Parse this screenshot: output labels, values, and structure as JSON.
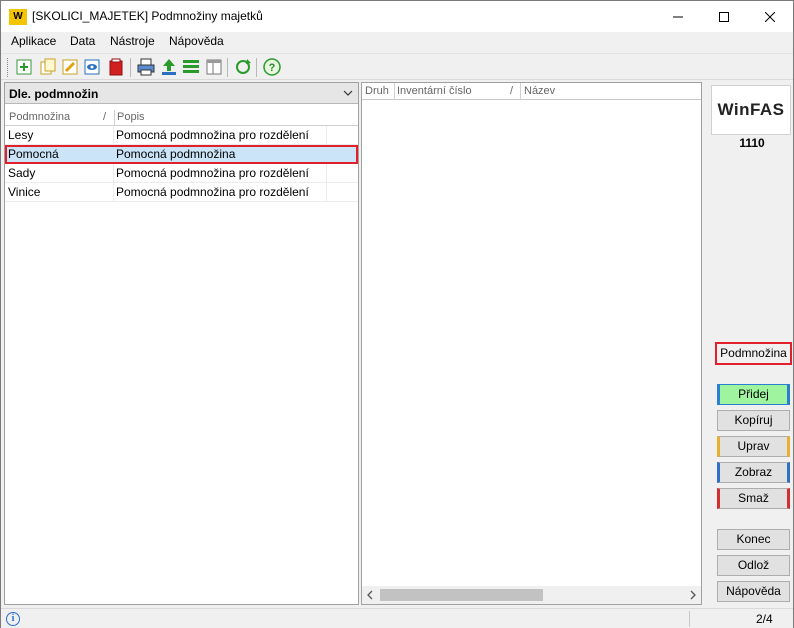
{
  "window": {
    "title": "[SKOLICI_MAJETEK] Podmnožiny majetků",
    "logo_text": "W"
  },
  "menu": [
    "Aplikace",
    "Data",
    "Nástroje",
    "Nápověda"
  ],
  "toolbar": {
    "icons": [
      "add-icon",
      "copy-icon",
      "edit-icon",
      "view-icon",
      "delete-icon",
      "print-icon",
      "export-icon",
      "list-icon",
      "columns-icon",
      "refresh-icon",
      "help-icon"
    ]
  },
  "left": {
    "combo_value": "Dle. podmnožin",
    "columns": [
      "Podmnožina",
      "/",
      "Popis"
    ],
    "rows": [
      {
        "name": "Lesy",
        "desc": "Pomocná podmnožina pro rozdělení"
      },
      {
        "name": "Pomocná",
        "desc": "Pomocná podmnožina"
      },
      {
        "name": "Sady",
        "desc": "Pomocná podmnožina pro rozdělení"
      },
      {
        "name": "Vinice",
        "desc": "Pomocná podmnožina pro rozdělení"
      }
    ]
  },
  "middle": {
    "columns": [
      "Druh",
      "Inventární číslo",
      "/",
      "Název"
    ]
  },
  "right": {
    "brand": "WinFAS",
    "code": "1110",
    "buttons": {
      "podmnozina": "Podmnožina",
      "pridej": "Přidej",
      "kopiruj": "Kopíruj",
      "uprav": "Uprav",
      "zobraz": "Zobraz",
      "smaz": "Smaž",
      "konec": "Konec",
      "odloz": "Odlož",
      "napoveda": "Nápověda"
    }
  },
  "status": {
    "count": "2/4",
    "info_glyph": "i"
  },
  "colors": {
    "highlight": "#e0202a",
    "selected_row": "#cce4f7",
    "add_button": "#9ff59f"
  }
}
